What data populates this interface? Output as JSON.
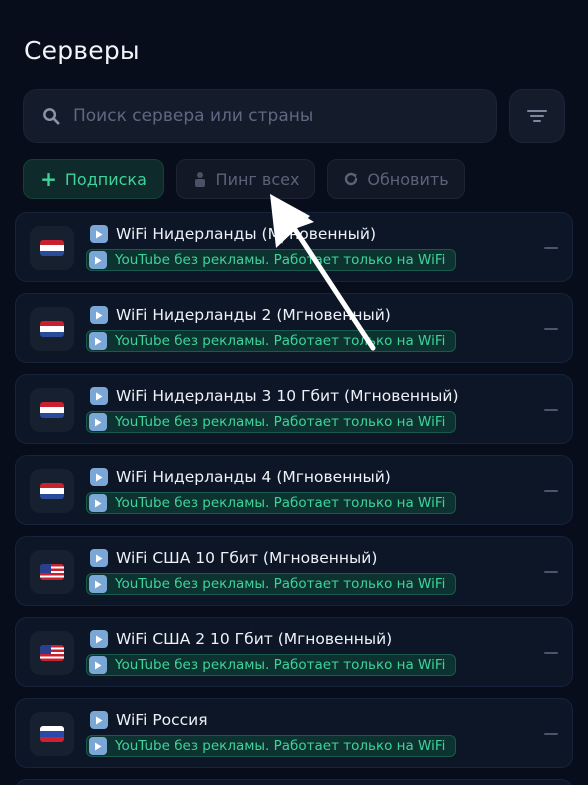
{
  "header": {
    "title": "Серверы"
  },
  "search": {
    "placeholder": "Поиск сервера или страны"
  },
  "actions": {
    "subscription_label": "Подписка",
    "ping_all_label": "Пинг всех",
    "refresh_label": "Обновить"
  },
  "servers": [
    {
      "name": "WiFi Нидерланды (Мгновенный)",
      "flag": "netherlands-flag-icon",
      "tag": "YouTube без рекламы. Работает только на WiFi"
    },
    {
      "name": "WiFi Нидерланды 2 (Мгновенный)",
      "flag": "netherlands-flag-icon",
      "tag": "YouTube без рекламы. Работает только на WiFi"
    },
    {
      "name": "WiFi Нидерланды 3 10 Гбит (Мгновенный)",
      "flag": "netherlands-flag-icon",
      "tag": "YouTube без рекламы. Работает только на WiFi"
    },
    {
      "name": "WiFi Нидерланды 4 (Мгновенный)",
      "flag": "netherlands-flag-icon",
      "tag": "YouTube без рекламы. Работает только на WiFi"
    },
    {
      "name": "WiFi США 10 Гбит (Мгновенный)",
      "flag": "usa-flag-icon",
      "tag": "YouTube без рекламы. Работает только на WiFi"
    },
    {
      "name": "WiFi США 2 10 Гбит (Мгновенный)",
      "flag": "usa-flag-icon",
      "tag": "YouTube без рекламы. Работает только на WiFi"
    },
    {
      "name": "WiFi Россия",
      "flag": "russia-flag-icon",
      "tag": "YouTube без рекламы. Работает только на WiFi"
    }
  ],
  "colors": {
    "background": "#080d1c",
    "accent_green": "#3fd39a",
    "card": "#0c1626"
  }
}
